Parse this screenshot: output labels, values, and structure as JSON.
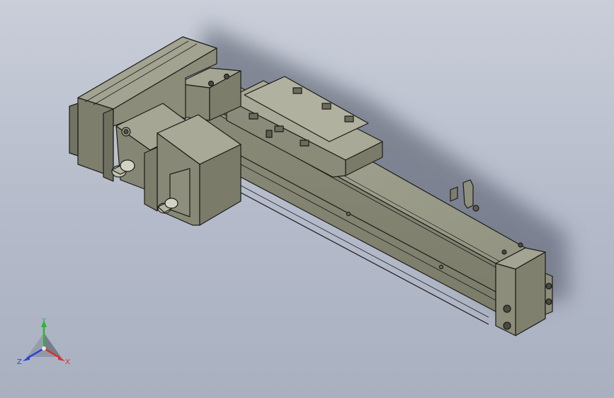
{
  "viewport": {
    "background_top": "#c9ced9",
    "background_bottom": "#a9b0c0"
  },
  "model": {
    "body_color": "#8e8f7c",
    "body_light": "#a2a392",
    "body_dark": "#6c6d5d",
    "edge_color": "#1c1c18",
    "shadow_color": "#5a5e6c"
  },
  "triad": {
    "x_label": "X",
    "y_label": "Y",
    "z_label": "Z",
    "x_color": "#d8322c",
    "y_color": "#2fb53a",
    "z_color": "#2a44d8"
  }
}
